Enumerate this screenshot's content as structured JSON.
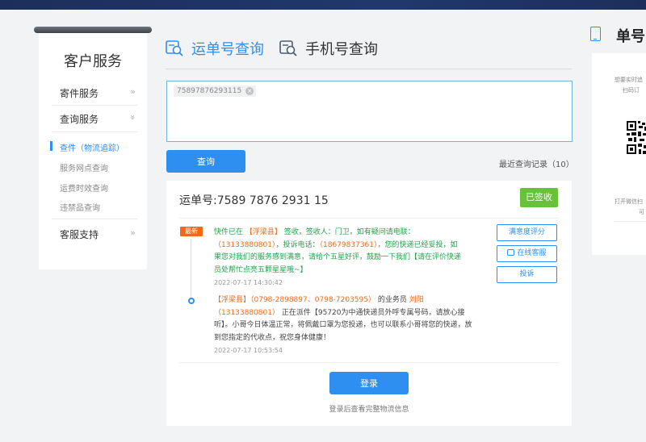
{
  "sidebar": {
    "title": "客户服务",
    "sections": [
      {
        "label": "寄件服务",
        "chevron": "»"
      },
      {
        "label": "查询服务",
        "chevron": "»"
      },
      {
        "label": "客服支持",
        "chevron": "»"
      }
    ],
    "sub_items": [
      {
        "label": "查件（物流追踪）",
        "active": true
      },
      {
        "label": "服务网点查询",
        "active": false
      },
      {
        "label": "运费时效查询",
        "active": false
      },
      {
        "label": "违禁品查询",
        "active": false
      }
    ]
  },
  "tabs": [
    {
      "label": "运单号查询",
      "active": true,
      "icon": "search-doc-icon"
    },
    {
      "label": "手机号查询",
      "active": false,
      "icon": "search-doc-icon"
    }
  ],
  "search": {
    "chip_value": "75897876293115"
  },
  "query_button": "查询",
  "recent_records": "最近查询记录（10）",
  "result": {
    "waybill_label": "运单号:7589 7876 2931 15",
    "status": "已签收",
    "new_badge": "最新",
    "event1": {
      "p1": "快件已在 ",
      "p2": "【浮梁县】",
      "p3": " 签收，签收人：门卫，如有疑问请电联：",
      "p4": "（13133880801）",
      "p5": "，投诉电话：",
      "p6": "（18679837361）",
      "p7": "，您的快递已经妥投，如果您对我们的服务感到满意，请给个五星好评，鼓励一下我们【请在评价快递员处帮忙点亮五颗星星哦~】",
      "time": "2022-07-17 14:30:42"
    },
    "event2": {
      "p1": "【浮梁县】（0798-2898897、0798-7203595）",
      "p2": " 的业务员 ",
      "p3": "刘阳",
      "p4": "（13133880801）",
      "p5": " 正在派件【95720为中通快递员外呼专属号码，请放心接听】。小哥今日体温正常，将佩戴口罩为您投递，也可以联系小哥将您的快递，放到您指定的代收点，祝您身体健康！",
      "time": "2022-07-17 10:53:54"
    },
    "buttons": {
      "rate": "满意度评分",
      "online": "在线客服",
      "complain": "投诉"
    },
    "login_button": "登录",
    "login_tip": "登录后查看完整物流信息"
  },
  "right_panel": {
    "title": "单号",
    "text1a": "想要实时追",
    "text1b": "扫码订",
    "text2a": "打开微信扫",
    "text2b": "可"
  },
  "colors": {
    "accent": "#2f8ff0",
    "success": "#67c23a",
    "highlight": "#f06a1c",
    "green_text": "#21a24b"
  }
}
